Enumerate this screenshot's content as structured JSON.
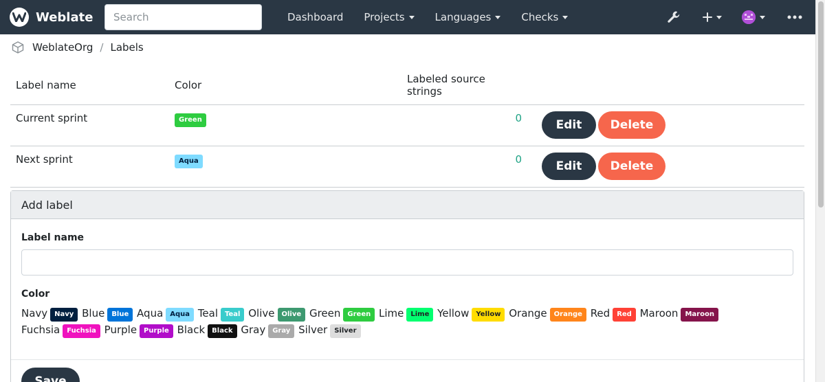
{
  "app": {
    "name": "Weblate"
  },
  "search": {
    "placeholder": "Search"
  },
  "nav": {
    "items": [
      {
        "label": "Dashboard"
      },
      {
        "label": "Projects"
      },
      {
        "label": "Languages"
      },
      {
        "label": "Checks"
      }
    ]
  },
  "breadcrumb": {
    "project": "WeblateOrg",
    "sep": "/",
    "page": "Labels"
  },
  "table": {
    "headers": {
      "name": "Label name",
      "color": "Color",
      "count": "Labeled source strings"
    },
    "rows": [
      {
        "name": "Current sprint",
        "color_label": "Green",
        "count": "0",
        "edit": "Edit",
        "delete": "Delete"
      },
      {
        "name": "Next sprint",
        "color_label": "Aqua",
        "count": "0",
        "edit": "Edit",
        "delete": "Delete"
      }
    ]
  },
  "form": {
    "title": "Add label",
    "name_label": "Label name",
    "color_label": "Color",
    "colors": [
      {
        "name": "Navy",
        "badge": "Navy",
        "bg": "#001f3f",
        "fg": "#ffffff"
      },
      {
        "name": "Blue",
        "badge": "Blue",
        "bg": "#0074d9",
        "fg": "#ffffff"
      },
      {
        "name": "Aqua",
        "badge": "Aqua",
        "bg": "#7fdbff",
        "fg": "#001f3f"
      },
      {
        "name": "Teal",
        "badge": "Teal",
        "bg": "#39cccc",
        "fg": "#ffffff"
      },
      {
        "name": "Olive",
        "badge": "Olive",
        "bg": "#3d9970",
        "fg": "#ffffff"
      },
      {
        "name": "Green",
        "badge": "Green",
        "bg": "#2ecc40",
        "fg": "#ffffff"
      },
      {
        "name": "Lime",
        "badge": "Lime",
        "bg": "#01ff70",
        "fg": "#1f2326"
      },
      {
        "name": "Yellow",
        "badge": "Yellow",
        "bg": "#ffdc00",
        "fg": "#1f2326"
      },
      {
        "name": "Orange",
        "badge": "Orange",
        "bg": "#ff851b",
        "fg": "#ffffff"
      },
      {
        "name": "Red",
        "badge": "Red",
        "bg": "#ff4136",
        "fg": "#ffffff"
      },
      {
        "name": "Maroon",
        "badge": "Maroon",
        "bg": "#85144b",
        "fg": "#ffffff"
      },
      {
        "name": "Fuchsia",
        "badge": "Fuchsia",
        "bg": "#f012be",
        "fg": "#ffffff"
      },
      {
        "name": "Purple",
        "badge": "Purple",
        "bg": "#b10dc9",
        "fg": "#ffffff"
      },
      {
        "name": "Black",
        "badge": "Black",
        "bg": "#111111",
        "fg": "#ffffff"
      },
      {
        "name": "Gray",
        "badge": "Gray",
        "bg": "#aaaaaa",
        "fg": "#ffffff"
      },
      {
        "name": "Silver",
        "badge": "Silver",
        "bg": "#dddddd",
        "fg": "#1f2326"
      }
    ],
    "save": "Save"
  },
  "theme": {
    "navbar_bg": "#2a3744",
    "edit_bg": "#2a3744",
    "delete_bg": "#f6664c",
    "count_color": "#1fa385"
  }
}
